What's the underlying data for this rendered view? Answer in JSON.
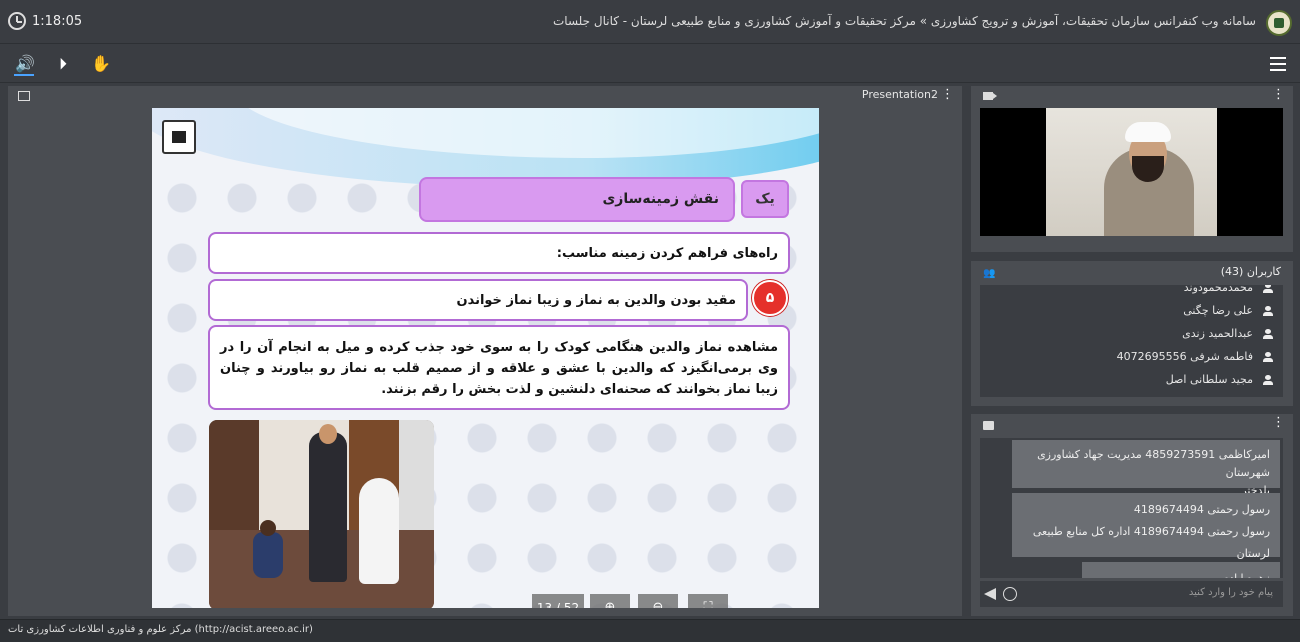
{
  "header": {
    "elapsed_time": "1:18:05",
    "title": "سامانه وب کنفرانس سازمان تحقیقات، آموزش و ترویج کشاورزی » مرکز تحقیقات و آموزش کشاورزی و منابع طبیعی لرستان - کانال جلسات"
  },
  "toolbar": {
    "audio_icon": "speaker-icon",
    "media_icon": "play-icon",
    "hand_icon": "raise-hand-icon",
    "menu_icon": "hamburger-icon"
  },
  "presentation": {
    "name": "Presentation2",
    "page_indicator": "13 / 52",
    "slide": {
      "heading": "نقش زمینه‌سازی",
      "heading_number": "یک",
      "box1": "راه‌های فراهم کردن زمینه مناسب:",
      "item_number": "۵",
      "box2": "مقید بودن والدین به نماز و زیبا نماز خواندن",
      "box3": "مشاهده نماز والدین هنگامی کودک را به سوی خود جذب کرده و میل به انجام آن را در وی برمی‌انگیزد که والدین با عشق و علاقه و از صمیم قلب به نماز رو بیاورند و چنان زیبا نماز بخوانند که صحنه‌ای دلنشین و لذت بخش را رقم بزنند."
    }
  },
  "users": {
    "title": "کاربران (43)",
    "list": [
      "محمدمحمودوند",
      "علی رضا چگنی",
      "عبدالحمید زندی",
      "فاطمه شرفی 4072695556",
      "مجید سلطانی اصل"
    ]
  },
  "chat": {
    "messages": [
      {
        "line1": "امیرکاظمی 4859273591 مدیریت جهاد کشاورزی شهرستان",
        "line2": "پلدختر"
      },
      {
        "line1": "رسول رحمتی 4189674494",
        "line2": "رسول رحمتی  4189674494 اداره کل منابع طبیعی لرستان"
      },
      {
        "line1": "زهره ابادی"
      }
    ],
    "input_placeholder": "پیام خود را وارد کنید"
  },
  "footer": {
    "text": "مرکز علوم و فناوری اطلاعات کشاورزی تات (http://acist.areeo.ac.ir)"
  },
  "colors": {
    "accent": "#4aa3ff",
    "slide_purple": "#d99af0",
    "slide_red": "#e5302b"
  }
}
